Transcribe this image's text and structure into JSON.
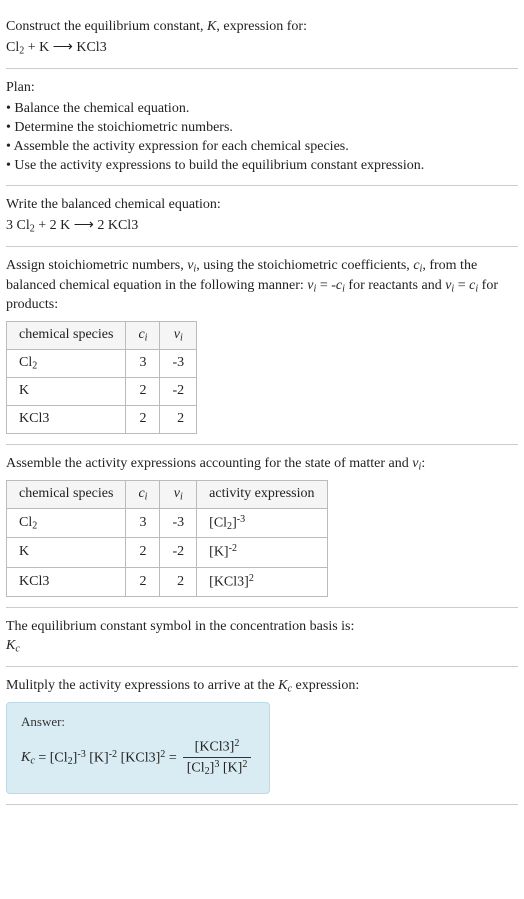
{
  "prompt": {
    "line1": "Construct the equilibrium constant, K, expression for:",
    "equation": "Cl₂ + K ⟶ KCl3"
  },
  "plan": {
    "header": "Plan:",
    "items": [
      "Balance the chemical equation.",
      "Determine the stoichiometric numbers.",
      "Assemble the activity expression for each chemical species.",
      "Use the activity expressions to build the equilibrium constant expression."
    ]
  },
  "balanced": {
    "header": "Write the balanced chemical equation:",
    "equation": "3 Cl₂ + 2 K ⟶ 2 KCl3"
  },
  "stoich": {
    "intro": "Assign stoichiometric numbers, νᵢ, using the stoichiometric coefficients, cᵢ, from the balanced chemical equation in the following manner: νᵢ = -cᵢ for reactants and νᵢ = cᵢ for products:",
    "headers": {
      "species": "chemical species",
      "ci": "cᵢ",
      "vi": "νᵢ"
    },
    "rows": [
      {
        "species": "Cl₂",
        "ci": "3",
        "vi": "-3"
      },
      {
        "species": "K",
        "ci": "2",
        "vi": "-2"
      },
      {
        "species": "KCl3",
        "ci": "2",
        "vi": "2"
      }
    ]
  },
  "activity": {
    "intro": "Assemble the activity expressions accounting for the state of matter and νᵢ:",
    "headers": {
      "species": "chemical species",
      "ci": "cᵢ",
      "vi": "νᵢ",
      "act": "activity expression"
    },
    "rows": [
      {
        "species": "Cl₂",
        "ci": "3",
        "vi": "-3",
        "act": "[Cl₂]⁻³"
      },
      {
        "species": "K",
        "ci": "2",
        "vi": "-2",
        "act": "[K]⁻²"
      },
      {
        "species": "KCl3",
        "ci": "2",
        "vi": "2",
        "act": "[KCl3]²"
      }
    ]
  },
  "symbol": {
    "line": "The equilibrium constant symbol in the concentration basis is:",
    "kc": "K_c"
  },
  "multiply": {
    "line": "Mulitply the activity expressions to arrive at the K_c expression:"
  },
  "answer": {
    "label": "Answer:",
    "lhs": "K_c = [Cl₂]⁻³ [K]⁻² [KCl3]² =",
    "num": "[KCl3]²",
    "den": "[Cl₂]³ [K]²"
  },
  "chart_data": {
    "type": "table",
    "tables": [
      {
        "title": "stoichiometric numbers",
        "columns": [
          "chemical species",
          "c_i",
          "ν_i"
        ],
        "rows": [
          [
            "Cl2",
            3,
            -3
          ],
          [
            "K",
            2,
            -2
          ],
          [
            "KCl3",
            2,
            2
          ]
        ]
      },
      {
        "title": "activity expressions",
        "columns": [
          "chemical species",
          "c_i",
          "ν_i",
          "activity expression"
        ],
        "rows": [
          [
            "Cl2",
            3,
            -3,
            "[Cl2]^-3"
          ],
          [
            "K",
            2,
            -2,
            "[K]^-2"
          ],
          [
            "KCl3",
            2,
            2,
            "[KCl3]^2"
          ]
        ]
      }
    ],
    "balanced_equation": "3 Cl2 + 2 K -> 2 KCl3",
    "equilibrium_expression": "K_c = [KCl3]^2 / ([Cl2]^3 [K]^2)"
  }
}
